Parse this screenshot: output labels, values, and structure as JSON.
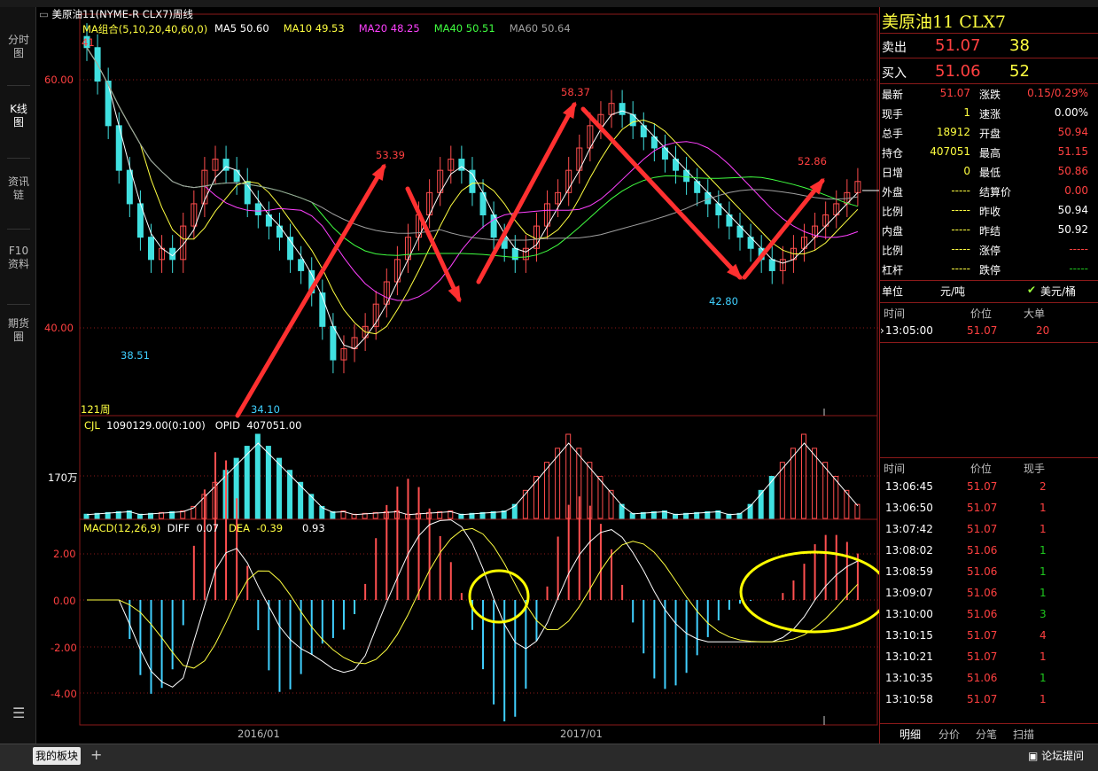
{
  "left_tabs": [
    "分时图",
    "K线图",
    "资讯链",
    "F10资料",
    "期货圈"
  ],
  "chart": {
    "title": "美原油11(NYME-R CLX7)周线",
    "ma": {
      "label": "MA组合(5,10,20,40,60,0)",
      "items": [
        {
          "text": "MA5 50.60",
          "color": "#ffffff"
        },
        {
          "text": "MA10 49.53",
          "color": "#ffff40"
        },
        {
          "text": "MA20 48.25",
          "color": "#ff40ff"
        },
        {
          "text": "MA40 50.51",
          "color": "#40ff40"
        },
        {
          "text": "MA60 50.64",
          "color": "#a0a0a0"
        }
      ]
    },
    "top_corner_value": "41",
    "price_axis": [
      "60.00",
      "40.00"
    ],
    "annotations": [
      "53.39",
      "58.37",
      "52.86",
      "38.51",
      "34.10",
      "42.80"
    ],
    "period_label": "121周",
    "volume": {
      "label": "CJL",
      "value": "1090129.00(0:100)",
      "opid_label": "OPID",
      "opid_value": "407051.00",
      "axis_label": "170万"
    },
    "macd": {
      "label": "MACD(12,26,9)",
      "diff_label": "DIFF",
      "diff": "0.07",
      "dea_label": "DEA",
      "dea": "-0.39",
      "macd_value": "0.93",
      "axis": [
        "2.00",
        "0.00",
        "-2.00",
        "-4.00"
      ]
    },
    "dates": [
      "2016/01",
      "2017/01"
    ]
  },
  "chart_data": {
    "type": "candlestick",
    "period": "weekly",
    "price_ylim": [
      30,
      66
    ],
    "key_prices": {
      "high_1": 53.39,
      "high_2": 58.37,
      "high_3": 52.86,
      "low_1": 38.51,
      "low_2": 34.1,
      "low_3": 42.8
    },
    "close_series": [
      63,
      60,
      56,
      52,
      49,
      46,
      44,
      45,
      44,
      47,
      49,
      52,
      53,
      52,
      51,
      49,
      48,
      47,
      46,
      44,
      43,
      41,
      38,
      35,
      36,
      37,
      38,
      40,
      42,
      44,
      46,
      48,
      50,
      52,
      53,
      52,
      50,
      48,
      46,
      45,
      44,
      45,
      47,
      49,
      50,
      52,
      54,
      56,
      57,
      58,
      57,
      56,
      55,
      54,
      53,
      52,
      51,
      50,
      49,
      48,
      47,
      46,
      45,
      44,
      43,
      44,
      45,
      46,
      47,
      48,
      49,
      50,
      51
    ],
    "macd_ylim": [
      -5,
      3
    ]
  },
  "quote": {
    "title": "美原油11  CLX7",
    "sell_label": "卖出",
    "sell_price": "51.07",
    "sell_vol": "38",
    "buy_label": "买入",
    "buy_price": "51.06",
    "buy_vol": "52",
    "rows": [
      {
        "l1": "最新",
        "v1": "51.07",
        "c1": "red",
        "l2": "涨跌",
        "v2": "0.15/0.29%",
        "c2": "red"
      },
      {
        "l1": "现手",
        "v1": "1",
        "c1": "yel",
        "l2": "速涨",
        "v2": "0.00%",
        "c2": "wht"
      },
      {
        "l1": "总手",
        "v1": "18912",
        "c1": "yel",
        "l2": "开盘",
        "v2": "50.94",
        "c2": "red"
      },
      {
        "l1": "持仓",
        "v1": "407051",
        "c1": "yel",
        "l2": "最高",
        "v2": "51.15",
        "c2": "red"
      },
      {
        "l1": "日增",
        "v1": "0",
        "c1": "yel",
        "l2": "最低",
        "v2": "50.86",
        "c2": "red"
      },
      {
        "l1": "外盘",
        "v1": "-----",
        "c1": "yel",
        "l2": "结算价",
        "v2": "0.00",
        "c2": "red"
      },
      {
        "l1": "比例",
        "v1": "-----",
        "c1": "yel",
        "l2": "昨收",
        "v2": "50.94",
        "c2": "wht"
      },
      {
        "l1": "内盘",
        "v1": "-----",
        "c1": "yel",
        "l2": "昨结",
        "v2": "50.92",
        "c2": "wht"
      },
      {
        "l1": "比例",
        "v1": "-----",
        "c1": "yel",
        "l2": "涨停",
        "v2": "-----",
        "c2": "red"
      },
      {
        "l1": "杠杆",
        "v1": "-----",
        "c1": "yel",
        "l2": "跌停",
        "v2": "-----",
        "c2": "grn"
      }
    ],
    "unit_label": "单位",
    "unit_value": "元/吨",
    "unit_check": "✔",
    "unit_alt": "美元/桶",
    "bigorder_header": [
      "时间",
      "价位",
      "大单"
    ],
    "bigorder": [
      {
        "time": "13:05:00",
        "price": "51.07",
        "vol": "20"
      }
    ],
    "ticks_header": [
      "时间",
      "价位",
      "现手"
    ],
    "ticks": [
      {
        "time": "13:06:45",
        "price": "51.07",
        "vol": "2",
        "pc": "red",
        "vc": "red"
      },
      {
        "time": "13:06:50",
        "price": "51.07",
        "vol": "1",
        "pc": "red",
        "vc": "red"
      },
      {
        "time": "13:07:42",
        "price": "51.07",
        "vol": "1",
        "pc": "red",
        "vc": "red"
      },
      {
        "time": "13:08:02",
        "price": "51.06",
        "vol": "1",
        "pc": "red",
        "vc": "grn"
      },
      {
        "time": "13:08:59",
        "price": "51.06",
        "vol": "1",
        "pc": "red",
        "vc": "grn"
      },
      {
        "time": "13:09:07",
        "price": "51.06",
        "vol": "1",
        "pc": "red",
        "vc": "grn"
      },
      {
        "time": "13:10:00",
        "price": "51.06",
        "vol": "3",
        "pc": "red",
        "vc": "grn"
      },
      {
        "time": "13:10:15",
        "price": "51.07",
        "vol": "4",
        "pc": "red",
        "vc": "red"
      },
      {
        "time": "13:10:21",
        "price": "51.07",
        "vol": "1",
        "pc": "red",
        "vc": "red"
      },
      {
        "time": "13:10:35",
        "price": "51.06",
        "vol": "1",
        "pc": "red",
        "vc": "grn"
      },
      {
        "time": "13:10:58",
        "price": "51.07",
        "vol": "1",
        "pc": "red",
        "vc": "red"
      }
    ],
    "bottom_tabs": [
      "明细",
      "分价",
      "分笔",
      "扫描"
    ]
  },
  "status": {
    "my_board": "我的板块",
    "plus": "+",
    "forum": "论坛提问"
  }
}
